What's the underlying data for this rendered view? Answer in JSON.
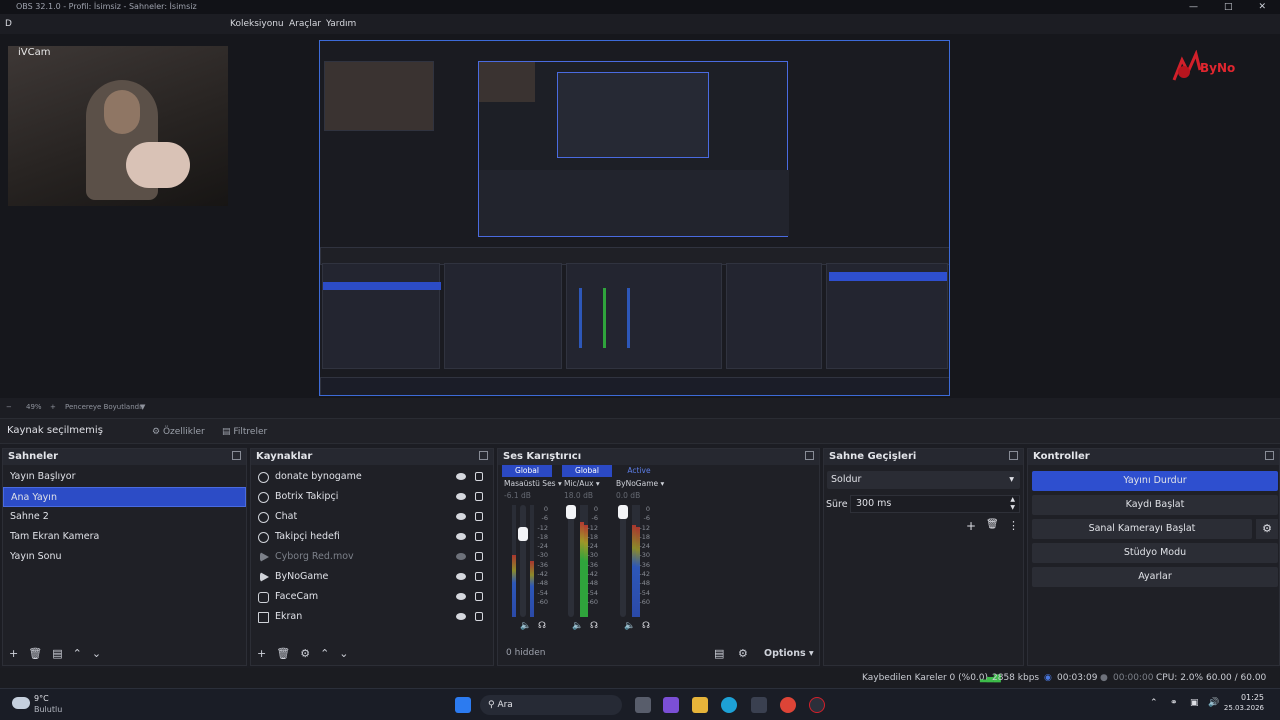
{
  "window": {
    "title": "OBS 32.1.0 - Profil: İsimsiz - Sahneler: İsimsiz"
  },
  "menu": {
    "file_initial": "D",
    "items": [
      "Koleksiyonu",
      "Araçlar",
      "Yardım"
    ]
  },
  "preview": {
    "webcam_label": "iVCam",
    "logo_text": "ByNo",
    "zoom": "49%",
    "fit_label": "Pencereye Boyutlandır"
  },
  "source_bar": {
    "status": "Kaynak seçilmemiş",
    "properties": "Özellikler",
    "filters": "Filtreler"
  },
  "scenes": {
    "title": "Sahneler",
    "items": [
      {
        "label": "Yayın Başlıyor",
        "selected": false
      },
      {
        "label": "Ana Yayın",
        "selected": true
      },
      {
        "label": "Sahne 2",
        "selected": false
      },
      {
        "label": "Tam Ekran Kamera",
        "selected": false
      },
      {
        "label": "Yayın Sonu",
        "selected": false
      }
    ]
  },
  "sources": {
    "title": "Kaynaklar",
    "items": [
      {
        "label": "donate bynogame",
        "icon": "browser-icon",
        "visible": true
      },
      {
        "label": "Botrix Takipçi",
        "icon": "browser-icon",
        "visible": true
      },
      {
        "label": "Chat",
        "icon": "browser-icon",
        "visible": true
      },
      {
        "label": "Takipçi hedefi",
        "icon": "browser-icon",
        "visible": true
      },
      {
        "label": "Cyborg Red.mov",
        "icon": "media-icon",
        "visible": false
      },
      {
        "label": "ByNoGame",
        "icon": "media-icon",
        "visible": true
      },
      {
        "label": "FaceCam",
        "icon": "camera-icon",
        "visible": true
      },
      {
        "label": "Ekran",
        "icon": "display-icon",
        "visible": true
      }
    ]
  },
  "mixer": {
    "title": "Ses Karıştırıcı",
    "channels": [
      {
        "tag": "Global",
        "name": "Masaüstü Ses",
        "db": "-6.1 dB",
        "level": 0.55,
        "volume": 0.8,
        "color": "#2d57b8"
      },
      {
        "tag": "Global",
        "name": "Mic/Aux",
        "db": "18.0 dB",
        "level": 0.85,
        "volume": 1.0,
        "color": "#2fa43c"
      },
      {
        "tag": "Active",
        "name": "ByNoGame",
        "db": "0.0 dB",
        "level": 0.82,
        "volume": 1.0,
        "color": "#2d57b8"
      }
    ],
    "scale": [
      "0",
      "-6",
      "-12",
      "-18",
      "-24",
      "-30",
      "-36",
      "-42",
      "-48",
      "-54",
      "-60"
    ],
    "hidden": "0 hidden",
    "options": "Options"
  },
  "transitions": {
    "title": "Sahne Geçişleri",
    "type": "Soldur",
    "duration_label": "Süre",
    "duration": "300 ms"
  },
  "controls": {
    "title": "Kontroller",
    "stop_stream": "Yayını Durdur",
    "start_record": "Kaydı Başlat",
    "virtual_cam": "Sanal Kamerayı Başlat",
    "studio_mode": "Stüdyo Modu",
    "settings": "Ayarlar"
  },
  "status": {
    "dropped": "Kaybedilen Kareler 0 (%0.0)",
    "bitrate": "2858 kbps",
    "stream_time": "00:03:09",
    "record_time": "00:00:00",
    "cpu": "CPU: 2.0%",
    "fps": "60.00 / 60.00 FPS"
  },
  "taskbar": {
    "weather_temp": "9°C",
    "weather_desc": "Bulutlu",
    "search": "Ara",
    "time": "01:25",
    "date": "25.03.2026"
  },
  "colors": {
    "accent": "#2e4fcf",
    "selection": "#2c4cc6",
    "panel": "#1f2026"
  }
}
